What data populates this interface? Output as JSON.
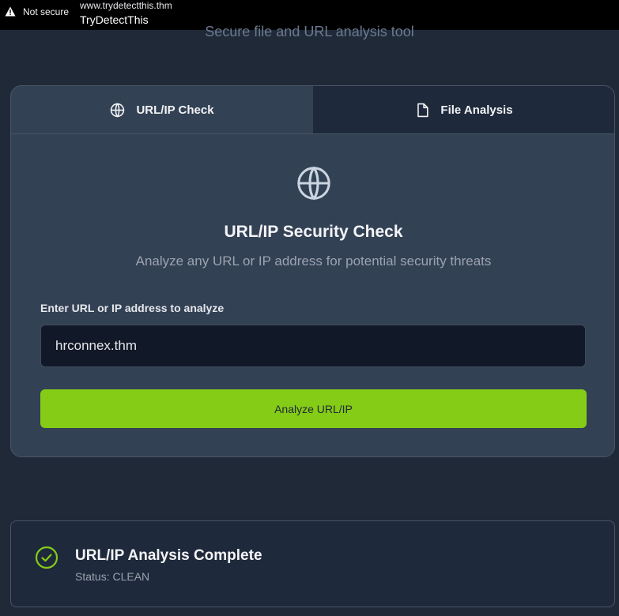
{
  "browser": {
    "security_label": "Not secure",
    "url": "www.trydetectthis.thm",
    "tab_title": "TryDetectThis"
  },
  "header": {
    "subtitle": "Secure file and URL analysis tool"
  },
  "tabs": [
    {
      "label": "URL/IP Check",
      "icon": "globe-icon",
      "active": true
    },
    {
      "label": "File Analysis",
      "icon": "file-icon",
      "active": false
    }
  ],
  "url_check": {
    "icon": "globe-icon",
    "title": "URL/IP Security Check",
    "description": "Analyze any URL or IP address for potential security threats",
    "field_label": "Enter URL or IP address to analyze",
    "input_value": "hrconnex.thm",
    "button_label": "Analyze URL/IP"
  },
  "result": {
    "icon": "check-circle-icon",
    "title": "URL/IP Analysis Complete",
    "status": "Status: CLEAN"
  },
  "colors": {
    "background": "#1f2937",
    "card": "#334155",
    "accent_button": "#84cc16",
    "success": "#84cc16"
  }
}
